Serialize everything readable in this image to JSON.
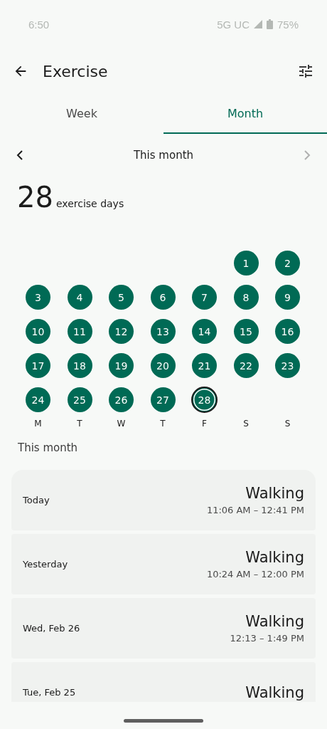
{
  "status_bar": {
    "time": "6:50",
    "network": "5G UC",
    "battery": "75%"
  },
  "app_bar": {
    "title": "Exercise"
  },
  "tabs": [
    {
      "label": "Week",
      "selected": false
    },
    {
      "label": "Month",
      "selected": true
    }
  ],
  "period_nav": {
    "label": "This month",
    "next_disabled": true
  },
  "summary": {
    "value": "28",
    "unit": "exercise days"
  },
  "calendar": {
    "weeks": [
      [
        {
          "kind": "empty"
        },
        {
          "kind": "empty"
        },
        {
          "kind": "empty"
        },
        {
          "kind": "empty"
        },
        {
          "kind": "empty"
        },
        {
          "day": "1",
          "exercised": true,
          "today": false
        },
        {
          "day": "2",
          "exercised": true,
          "today": false
        }
      ],
      [
        {
          "day": "3",
          "exercised": true,
          "today": false
        },
        {
          "day": "4",
          "exercised": true,
          "today": false
        },
        {
          "day": "5",
          "exercised": true,
          "today": false
        },
        {
          "day": "6",
          "exercised": true,
          "today": false
        },
        {
          "day": "7",
          "exercised": true,
          "today": false
        },
        {
          "day": "8",
          "exercised": true,
          "today": false
        },
        {
          "day": "9",
          "exercised": true,
          "today": false
        }
      ],
      [
        {
          "day": "10",
          "exercised": true,
          "today": false
        },
        {
          "day": "11",
          "exercised": true,
          "today": false
        },
        {
          "day": "12",
          "exercised": true,
          "today": false
        },
        {
          "day": "13",
          "exercised": true,
          "today": false
        },
        {
          "day": "14",
          "exercised": true,
          "today": false
        },
        {
          "day": "15",
          "exercised": true,
          "today": false
        },
        {
          "day": "16",
          "exercised": true,
          "today": false
        }
      ],
      [
        {
          "day": "17",
          "exercised": true,
          "today": false
        },
        {
          "day": "18",
          "exercised": true,
          "today": false
        },
        {
          "day": "19",
          "exercised": true,
          "today": false
        },
        {
          "day": "20",
          "exercised": true,
          "today": false
        },
        {
          "day": "21",
          "exercised": true,
          "today": false
        },
        {
          "day": "22",
          "exercised": true,
          "today": false
        },
        {
          "day": "23",
          "exercised": true,
          "today": false
        }
      ],
      [
        {
          "day": "24",
          "exercised": true,
          "today": false
        },
        {
          "day": "25",
          "exercised": true,
          "today": false
        },
        {
          "day": "26",
          "exercised": true,
          "today": false
        },
        {
          "day": "27",
          "exercised": true,
          "today": false
        },
        {
          "day": "28",
          "exercised": true,
          "today": true
        },
        {
          "kind": "empty"
        },
        {
          "kind": "empty"
        }
      ]
    ],
    "weekdays": [
      "M",
      "T",
      "W",
      "T",
      "F",
      "S",
      "S"
    ]
  },
  "section_title": "This month",
  "sessions": [
    {
      "date": "Today",
      "activity": "Walking",
      "time": "11:06 AM – 12:41 PM"
    },
    {
      "date": "Yesterday",
      "activity": "Walking",
      "time": "10:24 AM – 12:00 PM"
    },
    {
      "date": "Wed, Feb 26",
      "activity": "Walking",
      "time": "12:13 – 1:49 PM"
    },
    {
      "date": "Tue, Feb 25",
      "activity": "Walking"
    }
  ]
}
